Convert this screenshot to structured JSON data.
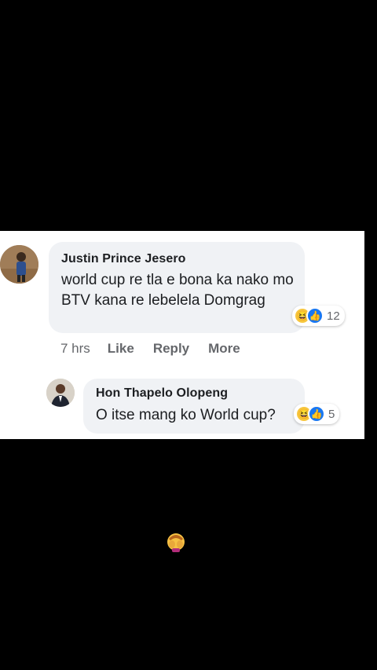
{
  "comment": {
    "author": "Justin Prince Jesero",
    "text": "world cup re tla e bona ka nako mo BTV kana re lebelela Domgrag",
    "reaction_count": "12",
    "actions": {
      "time": "7 hrs",
      "like": "Like",
      "reply": "Reply",
      "more": "More"
    }
  },
  "reply": {
    "author": "Hon Thapelo Olopeng",
    "text": "O itse mang ko World cup?",
    "reaction_count": "5"
  },
  "colors": {
    "background": "#000000",
    "bubble": "#f0f2f5",
    "like_blue": "#1877f2",
    "haha_yellow": "#f7c63d",
    "muted_text": "#65676b"
  },
  "icons": [
    "haha-reaction-icon",
    "like-reaction-icon",
    "face-palm-emoji-icon"
  ]
}
